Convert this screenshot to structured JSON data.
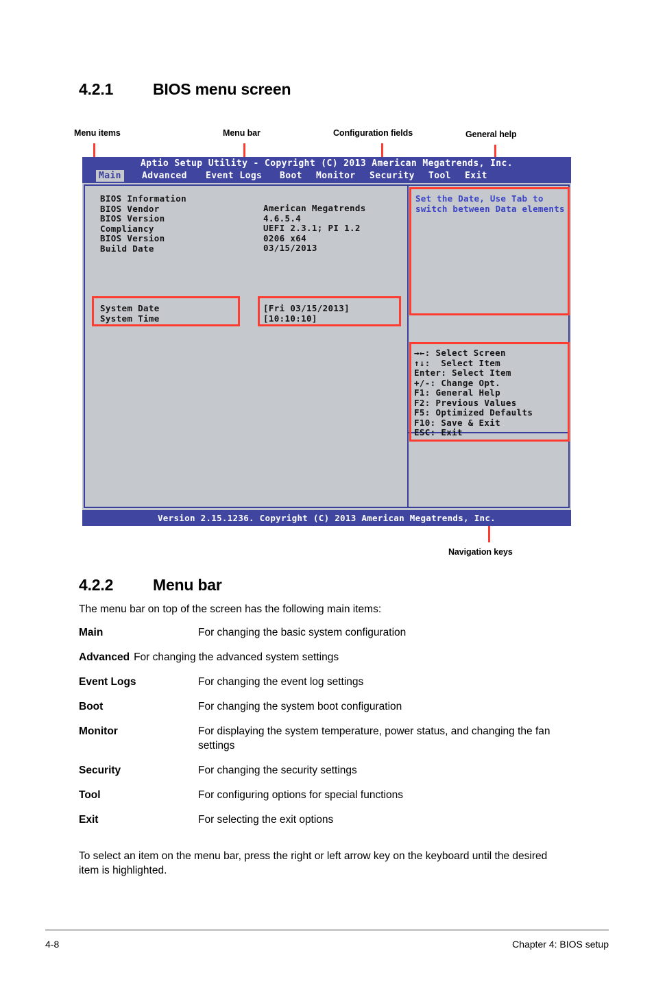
{
  "section_421": {
    "number": "4.2.1",
    "title": "BIOS menu screen"
  },
  "callouts": {
    "menu_items": "Menu items",
    "menu_bar": "Menu bar",
    "configuration_fields": "Configuration fields",
    "general_help": "General help",
    "navigation_keys": "Navigation keys"
  },
  "bios": {
    "title": "Aptio Setup Utility - Copyright (C) 2013 American Megatrends, Inc.",
    "menu_items": [
      "Main",
      "Advanced",
      "Event Logs",
      "Boot",
      "Monitor",
      "Security",
      "Tool",
      "Exit"
    ],
    "active_menu": "Main",
    "info_heading": "BIOS Information",
    "info_rows": [
      {
        "label": "BIOS Vendor",
        "value": "American Megatrends"
      },
      {
        "label": "BIOS Version",
        "value": "4.6.5.4"
      },
      {
        "label": "Compliancy",
        "value": "UEFI 2.3.1; PI 1.2"
      },
      {
        "label": "BIOS Version",
        "value": "0206 x64"
      },
      {
        "label": "Build Date",
        "value": "03/15/2013"
      }
    ],
    "info_labels_block": "BIOS Information\nBIOS Vendor\nBIOS Version\nCompliancy\nBIOS Version\nBuild Date",
    "info_values_block": "American Megatrends\n4.6.5.4\nUEFI 2.3.1; PI 1.2\n0206 x64\n03/15/2013",
    "config_labels_block": "System Date\nSystem Time",
    "config_values_block": "[Fri 03/15/2013]\n[10:10:10]",
    "config_rows": [
      {
        "label": "System Date",
        "value": "[Fri 03/15/2013]"
      },
      {
        "label": "System Time",
        "value": "[10:10:10]"
      }
    ],
    "help_text": "Set the Date, Use Tab to\nswitch between Data elements",
    "nav_keys_block": "→←: Select Screen\n↑↓:  Select Item\nEnter: Select Item\n+/-: Change Opt.\nF1: General Help\nF2: Previous Values\nF5: Optimized Defaults\nF10: Save & Exit\nESC: Exit",
    "nav_keys": [
      "→←: Select Screen",
      "↑↓:  Select Item",
      "Enter: Select Item",
      "+/-: Change Opt.",
      "F1: General Help",
      "F2: Previous Values",
      "F5: Optimized Defaults",
      "F10: Save & Exit",
      "ESC: Exit"
    ],
    "version_footer": "Version 2.15.1236. Copyright (C) 2013 American Megatrends, Inc.",
    "colors": {
      "header_blue": "#4045a0",
      "panel_gray": "#c5c8cd",
      "border_blue": "#3a3f9c",
      "help_text_blue": "#3a43c4",
      "callout_red": "#ff3c32"
    }
  },
  "section_422": {
    "number": "4.2.2",
    "title": "Menu bar",
    "intro": "The menu bar on top of the screen has the following main items:",
    "items": [
      {
        "term": "Main",
        "desc": "For changing the basic system configuration",
        "tight": false
      },
      {
        "term": "Advanced",
        "desc": "For changing the advanced system settings",
        "tight": true
      },
      {
        "term": "Event Logs",
        "desc": "For changing the event log settings",
        "tight": false
      },
      {
        "term": "Boot",
        "desc": "For changing the system boot configuration",
        "tight": false
      },
      {
        "term": "Monitor",
        "desc": "For displaying the system temperature, power status, and changing the fan settings",
        "tight": false
      },
      {
        "term": "Security",
        "desc": "For changing the security settings",
        "tight": false
      },
      {
        "term": "Tool",
        "desc": "For configuring options for special functions",
        "tight": false
      },
      {
        "term": "Exit",
        "desc": "For selecting the exit options",
        "tight": false
      }
    ],
    "outro": "To select an item on the menu bar, press the right or left arrow key on the keyboard until the desired item is highlighted."
  },
  "footer": {
    "page_number": "4-8",
    "chapter": "Chapter 4: BIOS setup"
  }
}
